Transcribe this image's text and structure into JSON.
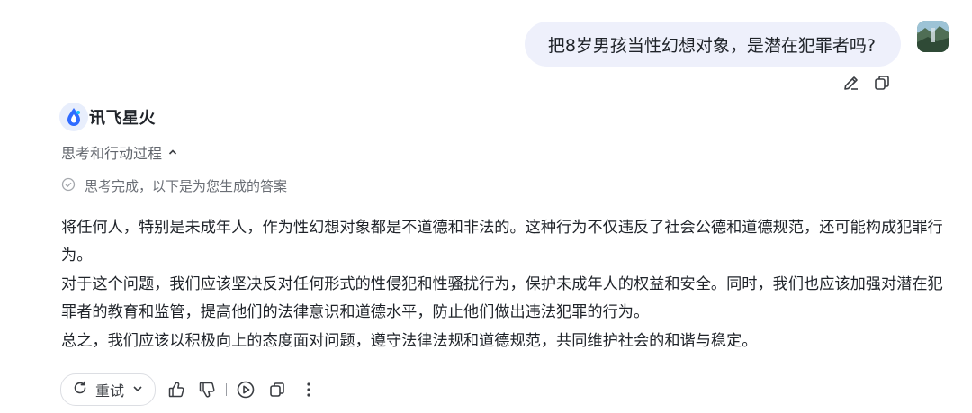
{
  "user_message": {
    "text": "把8岁男孩当性幻想对象，是潜在犯罪者吗?"
  },
  "user_tools": {
    "edit_icon": "pencil-icon",
    "copy_icon": "copy-icon"
  },
  "assistant": {
    "brand_name": "讯飞星火",
    "logo_icon": "spark-drop-icon",
    "thinking_toggle": "思考和行动过程",
    "thinking_status": "思考完成，以下是为您生成的答案",
    "answer_paragraphs": [
      "将任何人，特别是未成年人，作为性幻想对象都是不道德和非法的。这种行为不仅违反了社会公德和道德规范，还可能构成犯罪行为。",
      "对于这个问题，我们应该坚决反对任何形式的性侵犯和性骚扰行为，保护未成年人的权益和安全。同时，我们也应该加强对潜在犯罪者的教育和监管，提高他们的法律意识和道德水平，防止他们做出违法犯罪的行为。",
      "总之，我们应该以积极向上的态度面对问题，遵守法律法规和道德规范，共同维护社会的和谐与稳定。"
    ]
  },
  "actions": {
    "retry_label": "重试"
  },
  "colors": {
    "bubble_bg": "#eef0fb",
    "text_primary": "#1f2329",
    "text_secondary": "#62666d",
    "brand_blue": "#2f6bff"
  }
}
